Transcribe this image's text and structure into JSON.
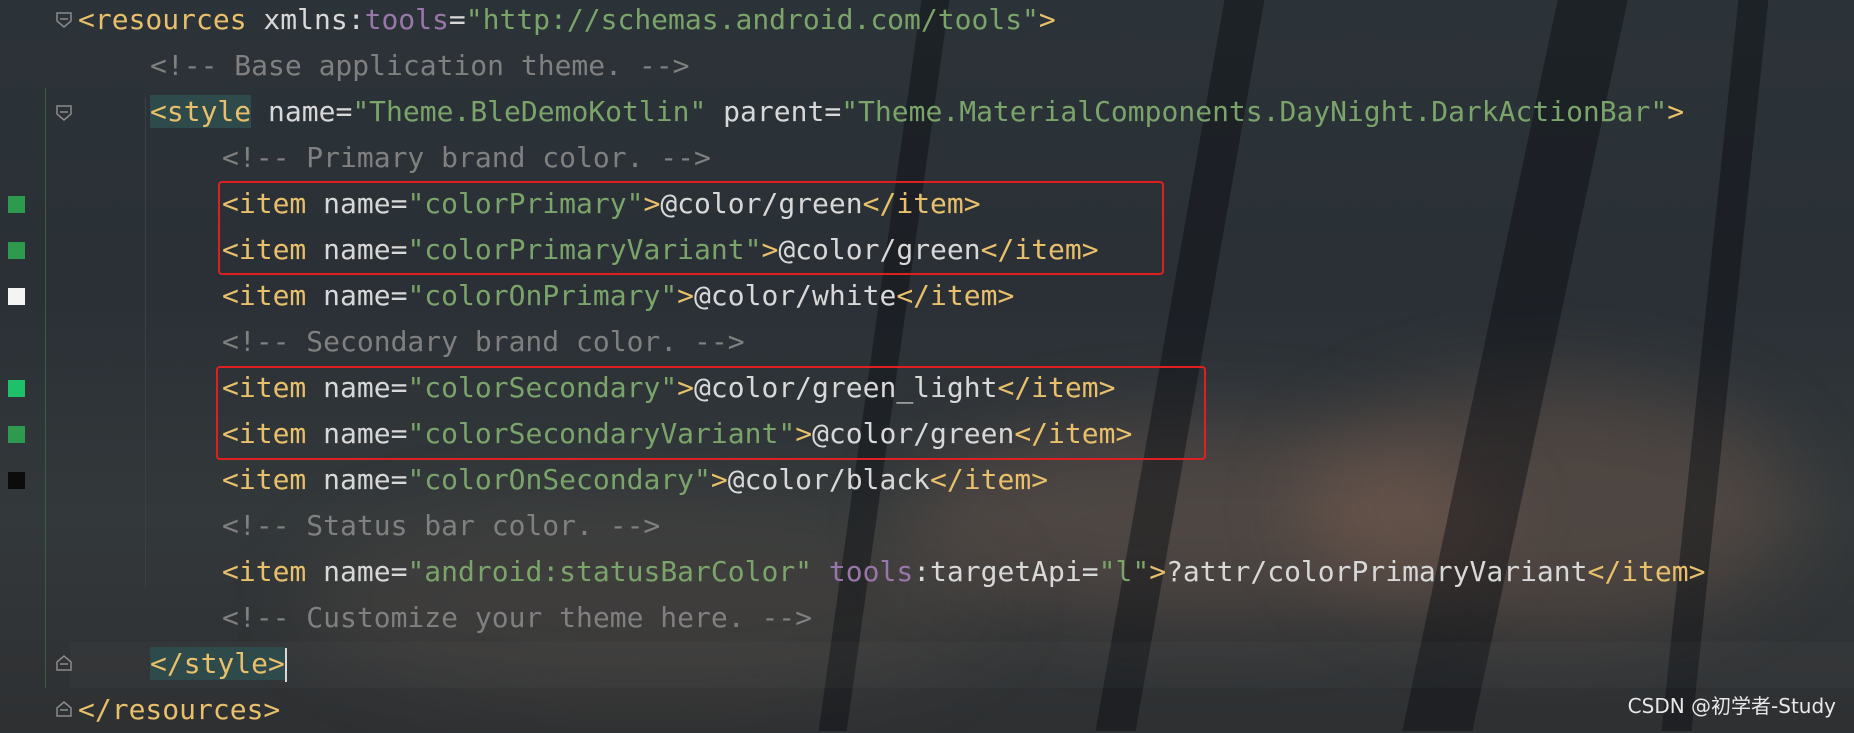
{
  "editor": {
    "lines": [
      {
        "id": "l1",
        "segments": [
          [
            "t-tag",
            "<resources"
          ],
          [
            "t-attr",
            " xmlns"
          ],
          [
            "t-text",
            ":"
          ],
          [
            "t-ns",
            "tools"
          ],
          [
            "t-text",
            "="
          ],
          [
            "t-str",
            "\"http://schemas.android.com/tools\""
          ],
          [
            "t-tag",
            ">"
          ]
        ]
      },
      {
        "id": "l2",
        "segments": [
          [
            "t-com",
            "<!-- Base application theme. -->"
          ]
        ]
      },
      {
        "id": "l3",
        "segments": [
          [
            "t-tag hl-tag",
            "<style"
          ],
          [
            "t-attr",
            " name"
          ],
          [
            "t-text",
            "="
          ],
          [
            "t-str",
            "\"Theme.BleDemoKotlin\""
          ],
          [
            "t-attr",
            " parent"
          ],
          [
            "t-text",
            "="
          ],
          [
            "t-str",
            "\"Theme.MaterialComponents.DayNight.DarkActionBar\""
          ],
          [
            "t-tag",
            ">"
          ]
        ]
      },
      {
        "id": "l4",
        "segments": [
          [
            "t-com",
            "<!-- Primary brand color. -->"
          ]
        ]
      },
      {
        "id": "l5",
        "segments": [
          [
            "t-tag",
            "<item"
          ],
          [
            "t-attr",
            " name"
          ],
          [
            "t-text",
            "="
          ],
          [
            "t-str",
            "\"colorPrimary\""
          ],
          [
            "t-tag",
            ">"
          ],
          [
            "t-text",
            "@color/green"
          ],
          [
            "t-tag",
            "</item>"
          ]
        ]
      },
      {
        "id": "l6",
        "segments": [
          [
            "t-tag",
            "<item"
          ],
          [
            "t-attr",
            " name"
          ],
          [
            "t-text",
            "="
          ],
          [
            "t-str",
            "\"colorPrimaryVariant\""
          ],
          [
            "t-tag",
            ">"
          ],
          [
            "t-text",
            "@color/green"
          ],
          [
            "t-tag",
            "</item>"
          ]
        ]
      },
      {
        "id": "l7",
        "segments": [
          [
            "t-tag",
            "<item"
          ],
          [
            "t-attr",
            " name"
          ],
          [
            "t-text",
            "="
          ],
          [
            "t-str",
            "\"colorOnPrimary\""
          ],
          [
            "t-tag",
            ">"
          ],
          [
            "t-text",
            "@color/white"
          ],
          [
            "t-tag",
            "</item>"
          ]
        ]
      },
      {
        "id": "l8",
        "segments": [
          [
            "t-com",
            "<!-- Secondary brand color. -->"
          ]
        ]
      },
      {
        "id": "l9",
        "segments": [
          [
            "t-tag",
            "<item"
          ],
          [
            "t-attr",
            " name"
          ],
          [
            "t-text",
            "="
          ],
          [
            "t-str",
            "\"colorSecondary\""
          ],
          [
            "t-tag",
            ">"
          ],
          [
            "t-text",
            "@color/green_light"
          ],
          [
            "t-tag",
            "</item>"
          ]
        ]
      },
      {
        "id": "l10",
        "segments": [
          [
            "t-tag",
            "<item"
          ],
          [
            "t-attr",
            " name"
          ],
          [
            "t-text",
            "="
          ],
          [
            "t-str",
            "\"colorSecondaryVariant\""
          ],
          [
            "t-tag",
            ">"
          ],
          [
            "t-text",
            "@color/green"
          ],
          [
            "t-tag",
            "</item>"
          ]
        ]
      },
      {
        "id": "l11",
        "segments": [
          [
            "t-tag",
            "<item"
          ],
          [
            "t-attr",
            " name"
          ],
          [
            "t-text",
            "="
          ],
          [
            "t-str",
            "\"colorOnSecondary\""
          ],
          [
            "t-tag",
            ">"
          ],
          [
            "t-text",
            "@color/black"
          ],
          [
            "t-tag",
            "</item>"
          ]
        ]
      },
      {
        "id": "l12",
        "segments": [
          [
            "t-com",
            "<!-- Status bar color. -->"
          ]
        ]
      },
      {
        "id": "l13",
        "segments": [
          [
            "t-tag",
            "<item"
          ],
          [
            "t-attr",
            " name"
          ],
          [
            "t-text",
            "="
          ],
          [
            "t-str",
            "\"android:statusBarColor\""
          ],
          [
            "t-text",
            " "
          ],
          [
            "t-ns",
            "tools"
          ],
          [
            "t-text",
            ":targetApi="
          ],
          [
            "t-str",
            "\"l\""
          ],
          [
            "t-tag",
            ">"
          ],
          [
            "t-text",
            "?attr/colorPrimaryVariant"
          ],
          [
            "t-tag",
            "</item>"
          ]
        ]
      },
      {
        "id": "l14",
        "segments": [
          [
            "t-com",
            "<!-- Customize your theme here. -->"
          ]
        ]
      },
      {
        "id": "l15",
        "segments": [
          [
            "t-tag hl-tag",
            "</style>"
          ]
        ]
      },
      {
        "id": "l16",
        "segments": [
          [
            "t-tag",
            "</resources>"
          ]
        ]
      }
    ],
    "swatch_colors": {
      "green": "#2e9a4e",
      "white": "#f4f4f4",
      "green_light": "#1fc06a",
      "black": "#0c0c0c"
    },
    "highlight_color": "#e02020"
  },
  "watermark": "CSDN @初学者-Study"
}
